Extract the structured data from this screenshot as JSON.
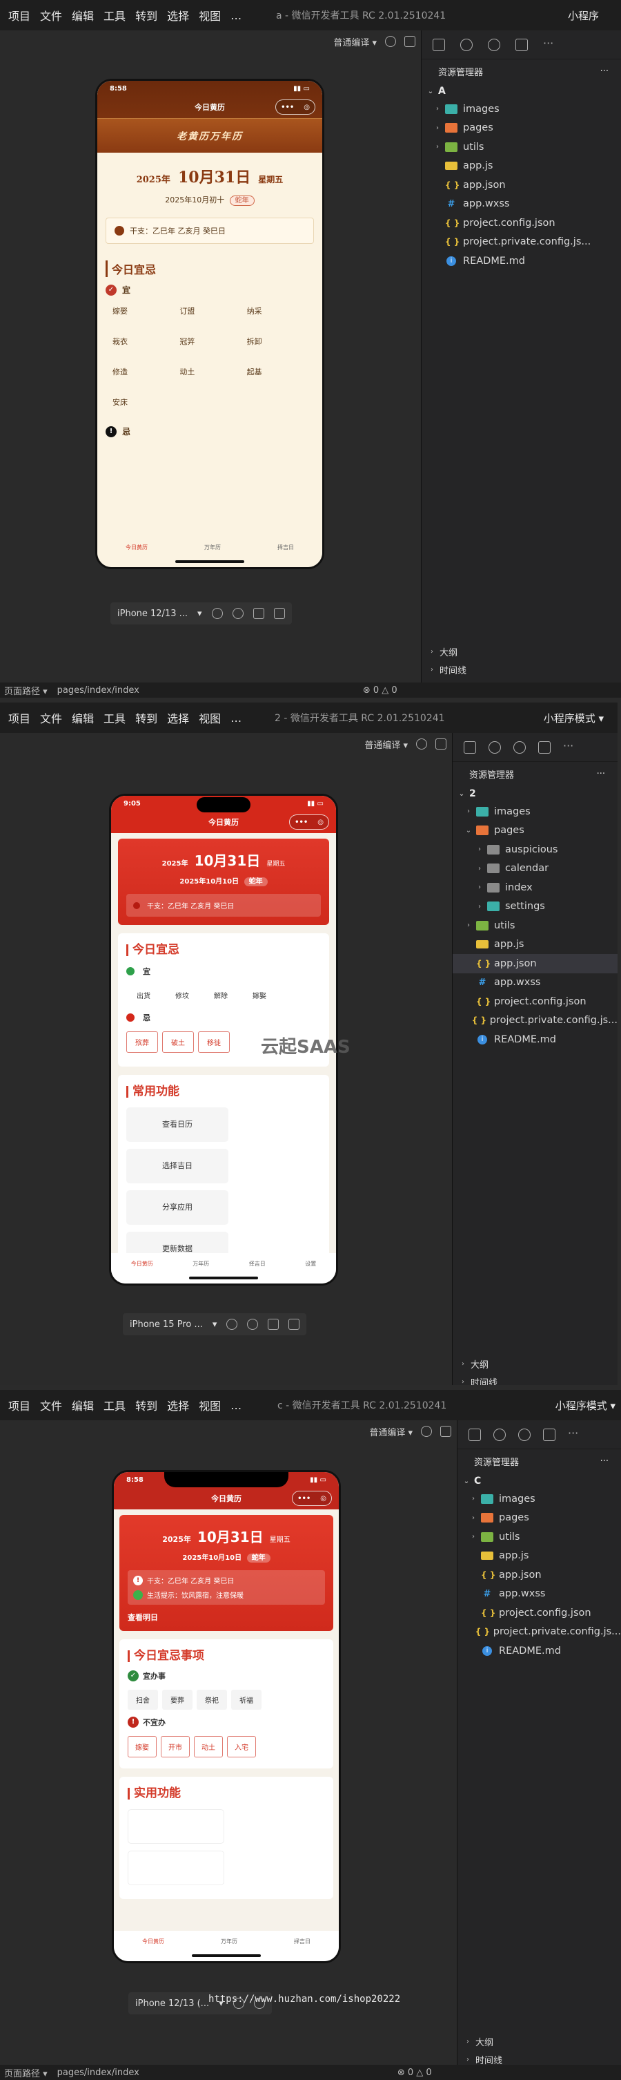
{
  "menu": [
    "项目",
    "文件",
    "编辑",
    "工具",
    "转到",
    "选择",
    "视图",
    "…"
  ],
  "windows": [
    {
      "title": "a - 微信开发者工具 RC 2.01.2510241",
      "mode": "小程序",
      "compile": "普通编译 ▾",
      "root": "A",
      "files": [
        {
          "name": "images",
          "type": "folder-img",
          "chev": "›"
        },
        {
          "name": "pages",
          "type": "folder-pages",
          "chev": "›"
        },
        {
          "name": "utils",
          "type": "folder-utils",
          "chev": "›"
        },
        {
          "name": "app.js",
          "type": "js"
        },
        {
          "name": "app.json",
          "type": "json"
        },
        {
          "name": "app.wxss",
          "type": "wxss"
        },
        {
          "name": "project.config.json",
          "type": "json"
        },
        {
          "name": "project.private.config.js...",
          "type": "json"
        },
        {
          "name": "README.md",
          "type": "info"
        }
      ],
      "outline": [
        "大纲",
        "时间线"
      ],
      "device": "iPhone 12/13 ...",
      "status_path": "页面路径 ▾",
      "status_page": "pages/index/index",
      "problems": "⊗ 0 △ 0",
      "app": {
        "time": "8:58",
        "nav_title": "今日黄历",
        "banner": "老黄历万年历",
        "year": "2025年",
        "date": "10月31日",
        "weekday": "星期五",
        "lunar": "2025年10月初十",
        "zodiac": "蛇年",
        "ganzhi": "干支：乙巳年 乙亥月 癸巳日",
        "section": "今日宜忌",
        "yi_label": "宜",
        "yi": [
          "嫁娶",
          "订盟",
          "纳采",
          "栽衣",
          "冠笄",
          "拆卸",
          "修造",
          "动土",
          "起基",
          "安床"
        ],
        "ji_label": "忌",
        "tabs": [
          "今日黄历",
          "万年历",
          "择吉日"
        ]
      }
    },
    {
      "title": "2 - 微信开发者工具 RC 2.01.2510241",
      "mode": "小程序模式 ▾",
      "compile": "普通编译 ▾",
      "root": "2",
      "files": [
        {
          "name": "images",
          "type": "folder-img",
          "chev": "›",
          "indent": 1
        },
        {
          "name": "pages",
          "type": "folder-pages",
          "chev": "⌄",
          "indent": 1
        },
        {
          "name": "auspicious",
          "type": "folder",
          "chev": "›",
          "indent": 2
        },
        {
          "name": "calendar",
          "type": "folder",
          "chev": "›",
          "indent": 2
        },
        {
          "name": "index",
          "type": "folder",
          "chev": "›",
          "indent": 2
        },
        {
          "name": "settings",
          "type": "folder-img",
          "chev": "›",
          "indent": 2
        },
        {
          "name": "utils",
          "type": "folder-utils",
          "chev": "›",
          "indent": 1
        },
        {
          "name": "app.js",
          "type": "js",
          "indent": 1
        },
        {
          "name": "app.json",
          "type": "json",
          "indent": 1,
          "selected": true
        },
        {
          "name": "app.wxss",
          "type": "wxss",
          "indent": 1
        },
        {
          "name": "project.config.json",
          "type": "json",
          "indent": 1
        },
        {
          "name": "project.private.config.js...",
          "type": "json",
          "indent": 1
        },
        {
          "name": "README.md",
          "type": "info",
          "indent": 1
        }
      ],
      "outline": [
        "大纲",
        "时间线"
      ],
      "device": "iPhone 15 Pro ...",
      "watermark": "云起SAAS",
      "app": {
        "time": "9:05",
        "nav_title": "今日黄历",
        "year": "2025年",
        "date": "10月31日",
        "weekday": "星期五",
        "lunar": "2025年10月10日",
        "zodiac": "蛇年",
        "ganzhi": "干支：乙巳年 乙亥月 癸巳日",
        "section": "今日宜忌",
        "yi_label": "宜",
        "yi": [
          "出货",
          "修坟",
          "解除",
          "嫁娶"
        ],
        "ji_label": "忌",
        "ji": [
          "殡葬",
          "破土",
          "移徙"
        ],
        "section2": "常用功能",
        "functions": [
          "查看日历",
          "选择吉日",
          "分享应用",
          "更新数据"
        ],
        "tabs": [
          "今日黄历",
          "万年历",
          "择吉日",
          "设置"
        ]
      }
    },
    {
      "title": "c - 微信开发者工具 RC 2.01.2510241",
      "mode": "小程序模式 ▾",
      "compile": "普通编译 ▾",
      "root": "C",
      "files": [
        {
          "name": "images",
          "type": "folder-img",
          "chev": "›"
        },
        {
          "name": "pages",
          "type": "folder-pages",
          "chev": "›"
        },
        {
          "name": "utils",
          "type": "folder-utils",
          "chev": "›"
        },
        {
          "name": "app.js",
          "type": "js"
        },
        {
          "name": "app.json",
          "type": "json"
        },
        {
          "name": "app.wxss",
          "type": "wxss"
        },
        {
          "name": "project.config.json",
          "type": "json"
        },
        {
          "name": "project.private.config.js...",
          "type": "json"
        },
        {
          "name": "README.md",
          "type": "info"
        }
      ],
      "outline": [
        "大纲",
        "时间线"
      ],
      "device": "iPhone 12/13 (...",
      "url": "https://www.huzhan.com/ishop20222",
      "status_path": "页面路径 ▾",
      "status_page": "pages/index/index",
      "problems": "⊗ 0 △ 0",
      "app": {
        "time": "8:58",
        "nav_title": "今日黄历",
        "year": "2025年",
        "date": "10月31日",
        "weekday": "星期五",
        "lunar": "2025年10月10日",
        "zodiac": "蛇年",
        "ganzhi": "干支：乙巳年 乙亥月 癸巳日",
        "tip": "生活提示：饮风露宿，注意保暖",
        "tomorrow": "查看明日",
        "section": "今日宜忌事项",
        "yi_label": "宜办事",
        "yi": [
          "扫舍",
          "要葬",
          "祭祀",
          "祈福"
        ],
        "ji_label": "不宜办",
        "ji": [
          "嫁娶",
          "开市",
          "动土",
          "入宅"
        ],
        "section2": "实用功能",
        "tabs": [
          "今日黄历",
          "万年历",
          "择吉日"
        ]
      }
    }
  ],
  "colors": {
    "accent": "#d43b2a",
    "brown": "#8a3a12",
    "cream": "#fbf3e2",
    "ide_bg": "#1e1e1e"
  }
}
